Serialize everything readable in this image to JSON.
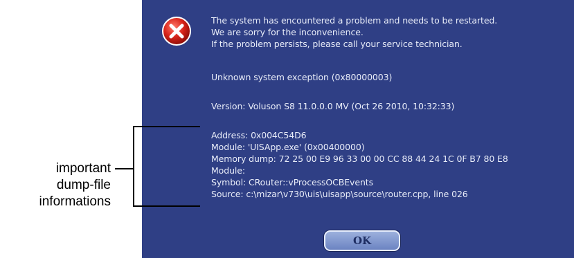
{
  "dialog": {
    "background_color": "#2f3f85",
    "icon": "error-icon",
    "message_lines": [
      "The system has encountered a problem and needs to be restarted.",
      "We are sorry for the inconvenience.",
      "If the problem persists, please call your service technician."
    ],
    "exception": "Unknown system exception (0x80000003)",
    "version": "Version: Voluson S8 11.0.0.0 MV (Oct 26 2010, 10:32:33)",
    "dump_lines": [
      "Address: 0x004C54D6",
      "Module: 'UISApp.exe' (0x00400000)",
      "Memory dump: 72 25 00 E9 96 33 00 00 CC 88 44 24 1C 0F B7 80 E8",
      "Module:",
      "Symbol: CRouter::vProcessOCBEvents",
      "Source: c:\\mizar\\v730\\uis\\uisapp\\source\\router.cpp, line 026"
    ],
    "ok_label": "OK"
  },
  "annotation": {
    "lines": [
      "important",
      "dump-file",
      "informations"
    ]
  }
}
